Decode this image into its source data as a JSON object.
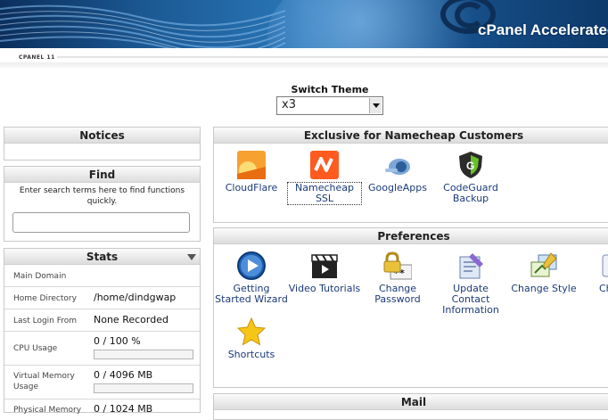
{
  "header": {
    "logo_text": "cPanel Accelerated",
    "version_label": "CPANEL 11"
  },
  "switch_theme": {
    "title": "Switch Theme",
    "selected": "x3"
  },
  "notices": {
    "title": "Notices"
  },
  "find": {
    "title": "Find",
    "description": "Enter search terms here to find functions quickly.",
    "input_value": ""
  },
  "stats": {
    "title": "Stats",
    "rows": [
      {
        "label": "Main Domain",
        "value": ""
      },
      {
        "label": "Home Directory",
        "value": "/home/dindgwap"
      },
      {
        "label": "Last Login From",
        "value": "None Recorded"
      },
      {
        "label": "CPU Usage",
        "value": "0 / 100 %",
        "bar_fraction": 0
      },
      {
        "label": "Virtual Memory Usage",
        "value": "0 / 4096 MB",
        "bar_fraction": 0
      },
      {
        "label": "Physical Memory",
        "value": "0 / 1024 MB"
      }
    ]
  },
  "exclusive": {
    "title": "Exclusive for Namecheap Customers",
    "items": [
      {
        "label": "CloudFlare",
        "icon": "cloudflare-icon"
      },
      {
        "label": "Namecheap SSL",
        "icon": "namecheap-ssl-icon"
      },
      {
        "label": "GoogleApps",
        "icon": "google-apps-icon"
      },
      {
        "label": "CodeGuard Backup",
        "icon": "codeguard-icon"
      }
    ]
  },
  "preferences": {
    "title": "Preferences",
    "items": [
      {
        "label": "Getting Started Wizard",
        "icon": "play-icon"
      },
      {
        "label": "Video Tutorials",
        "icon": "clapperboard-icon"
      },
      {
        "label": "Change Password",
        "icon": "password-lock-icon"
      },
      {
        "label": "Update Contact Information",
        "icon": "contact-icon"
      },
      {
        "label": "Change Style",
        "icon": "style-icon"
      },
      {
        "label": "Ch La",
        "icon": "language-icon"
      },
      {
        "label": "Shortcuts",
        "icon": "star-icon"
      }
    ]
  },
  "mail": {
    "title": "Mail"
  },
  "colors": {
    "link": "#1a3a78",
    "box_border": "#c9c9c9",
    "header_blue": "#1c5a95"
  }
}
